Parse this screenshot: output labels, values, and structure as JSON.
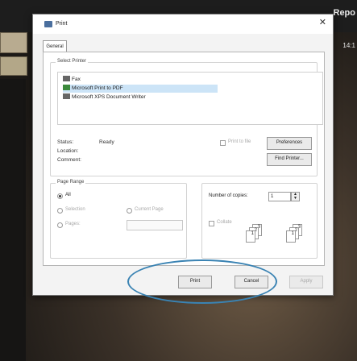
{
  "background": {
    "app_title_fragment": "Repo",
    "time_fragment": "14:1",
    "oval_color": "#3a83b3"
  },
  "dialog": {
    "title": "Print",
    "close_glyph": "✕",
    "tab_general": "General",
    "select_printer": {
      "legend": "Select Printer",
      "printers": [
        "Fax",
        "Microsoft Print to PDF",
        "Microsoft XPS Document Writer"
      ],
      "selected_index": 1,
      "status_label": "Status:",
      "status_value": "Ready",
      "location_label": "Location:",
      "comment_label": "Comment:",
      "print_to_file_label": "Print to file",
      "preferences_button": "Preferences",
      "find_printer_button": "Find Printer..."
    },
    "page_range": {
      "legend": "Page Range",
      "all": "All",
      "selection": "Selection",
      "current_page": "Current Page",
      "pages": "Pages:"
    },
    "copies": {
      "number_label": "Number of copies:",
      "number_value": "1",
      "collate_label": "Collate",
      "card_pages": [
        "1",
        "2",
        "3"
      ]
    },
    "buttons": {
      "print": "Print",
      "cancel": "Cancel",
      "apply": "Apply"
    }
  }
}
